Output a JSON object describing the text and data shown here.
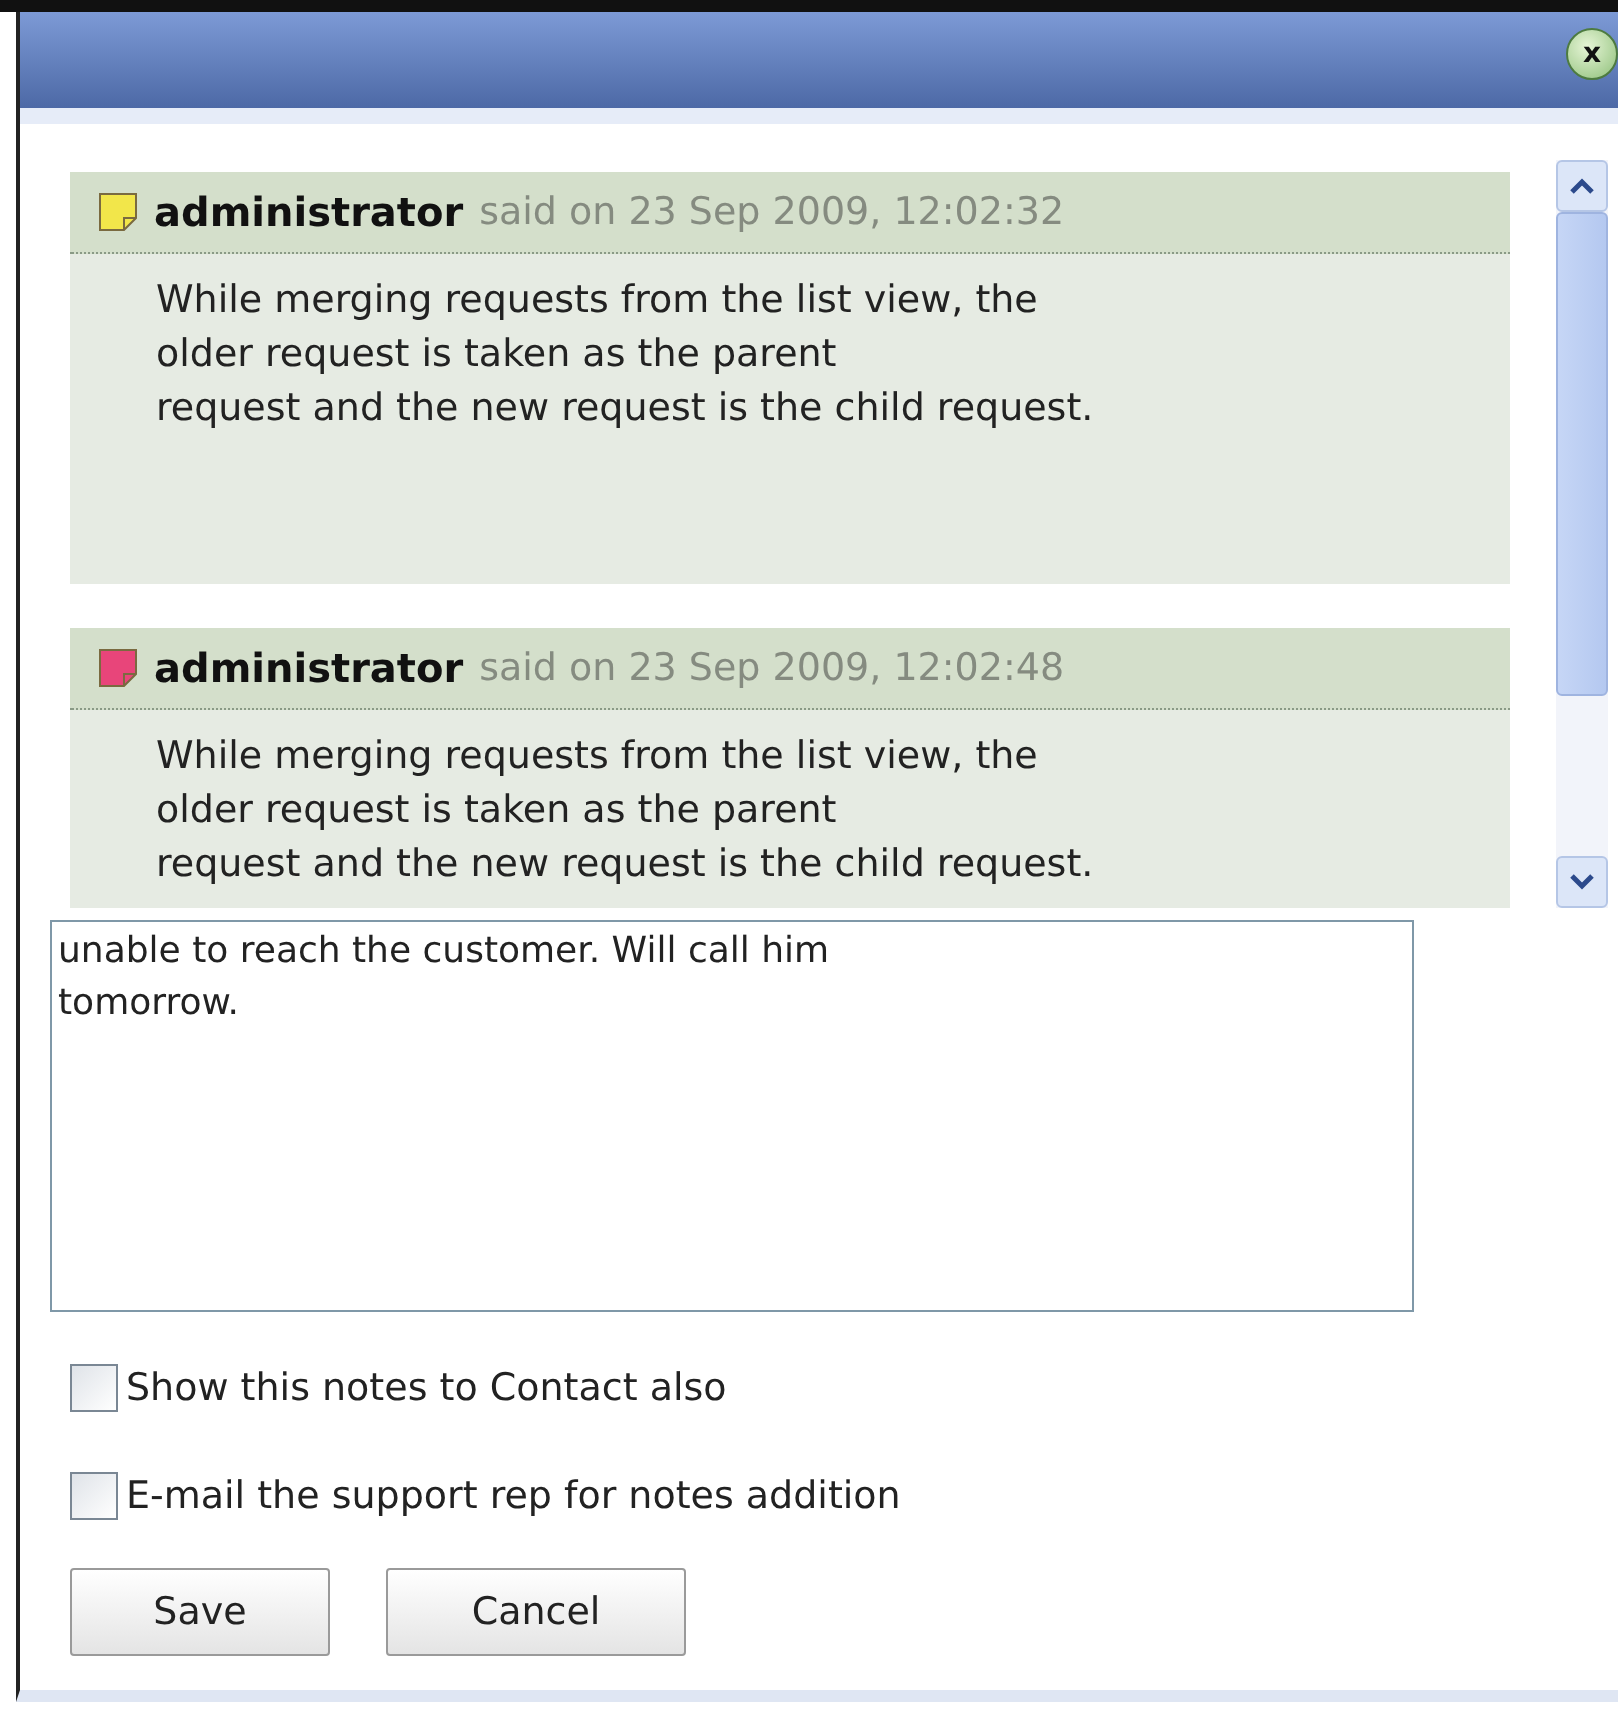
{
  "close_button": {
    "label": "x"
  },
  "notes": [
    {
      "author": "administrator",
      "meta": "said on 23 Sep 2009, 12:02:32",
      "color": "#f2e64a",
      "lines": [
        "While merging requests from the list view, the",
        "older request is taken as the parent",
        "request and the new request is the child request."
      ]
    },
    {
      "author": "administrator",
      "meta": "said on 23 Sep 2009, 12:02:48",
      "color": "#e8457a",
      "lines": [
        "While merging requests from the list view, the",
        "older request is taken as the parent",
        "request and the new request is the child request."
      ]
    }
  ],
  "note_input": {
    "value": "unable to reach the customer. Will call him\ntomorrow."
  },
  "options": [
    {
      "label": "Show this notes to Contact also",
      "checked": false
    },
    {
      "label": "E-mail the support rep for notes addition",
      "checked": false
    }
  ],
  "buttons": [
    "Save",
    "Cancel"
  ]
}
